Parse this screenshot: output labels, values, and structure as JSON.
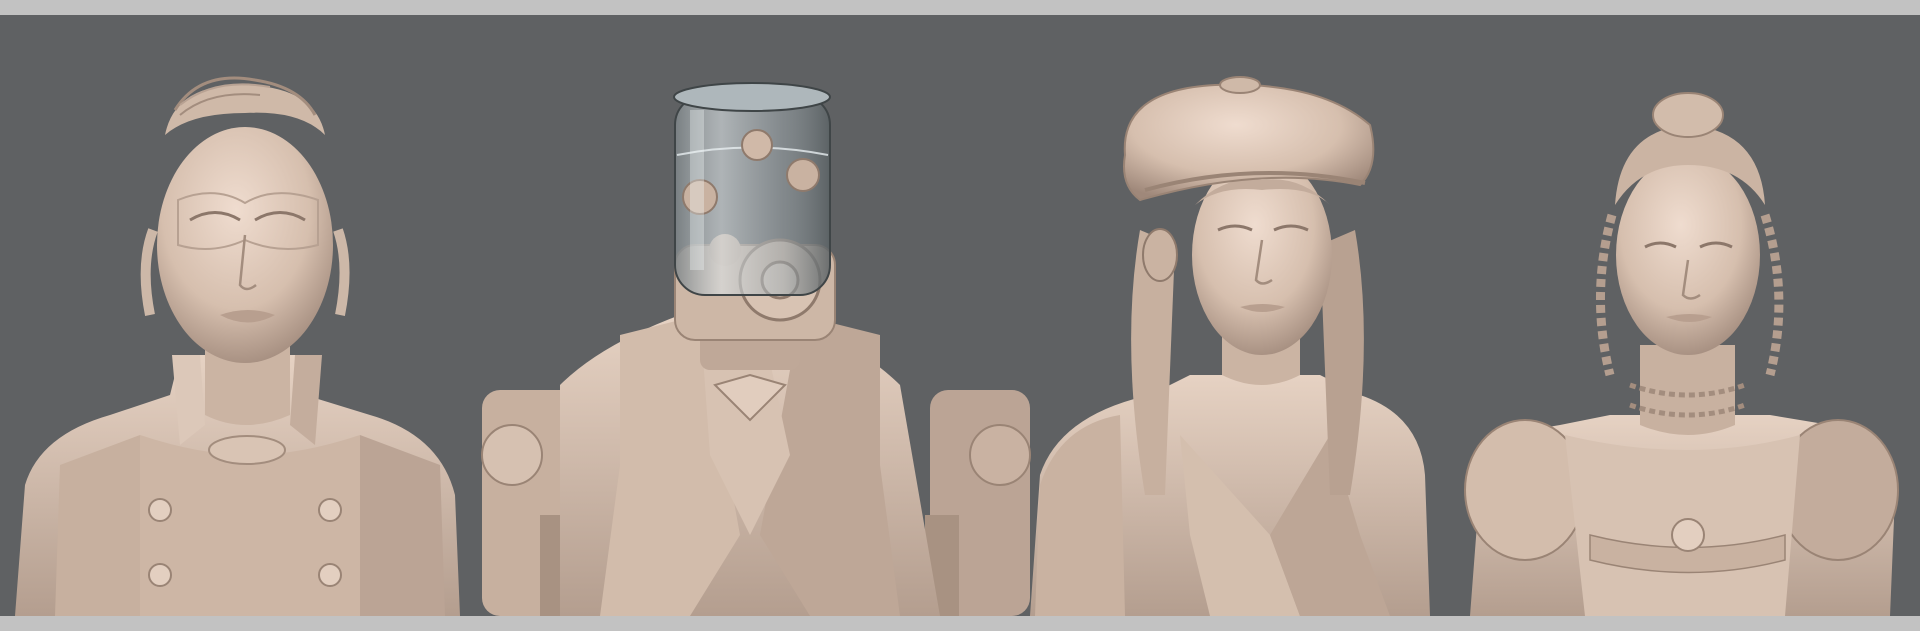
{
  "scene": {
    "background_color": "#5f6163",
    "border_color": "#c2c2c2",
    "clay_color": "#d8c2b2",
    "clay_shadow": "#a48e80",
    "clay_highlight": "#efdccf",
    "glass_color": "#c9d2d6"
  },
  "figures": [
    {
      "name": "woman-with-pompadour-and-jacket",
      "icon": "bust-icon"
    },
    {
      "name": "robot-with-glass-jar-head",
      "icon": "jar-robot-icon"
    },
    {
      "name": "girl-with-newsboy-cap",
      "icon": "cap-bust-icon"
    },
    {
      "name": "girl-with-braided-hair-and-puff-sleeves",
      "icon": "braid-bust-icon"
    }
  ]
}
